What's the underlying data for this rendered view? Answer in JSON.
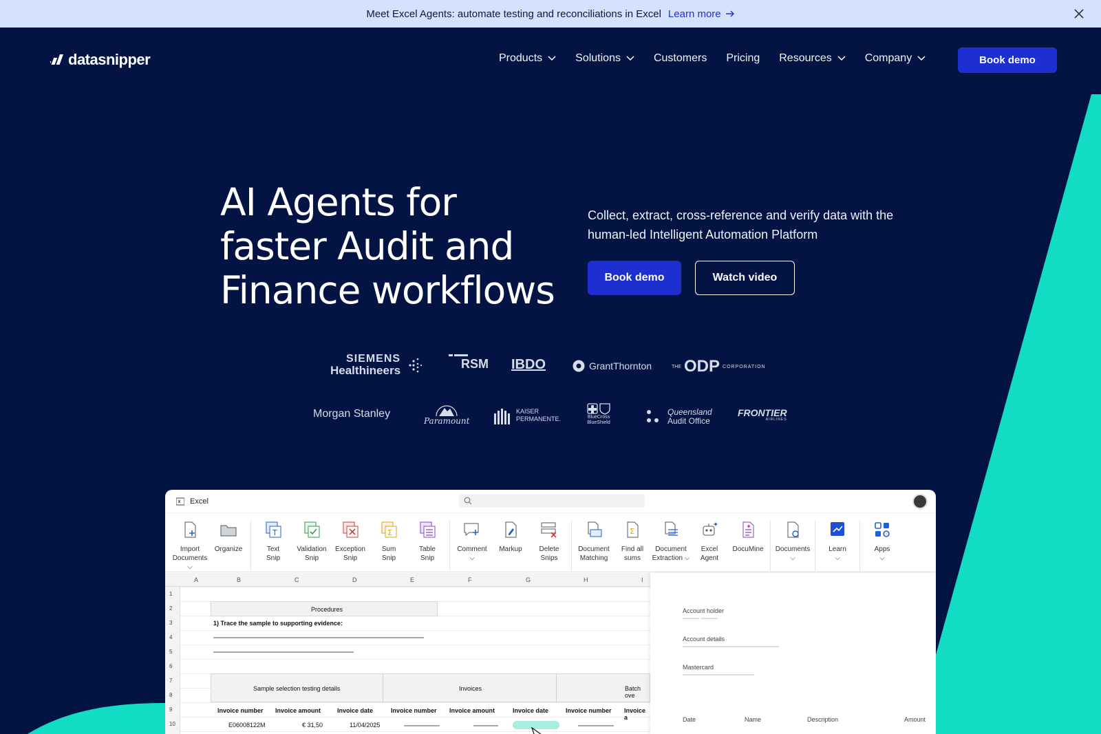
{
  "banner": {
    "text": "Meet Excel Agents: automate testing and reconciliations in Excel",
    "link": "Learn more"
  },
  "nav": {
    "logo": "datasnipper",
    "items": [
      {
        "label": "Products",
        "dropdown": true
      },
      {
        "label": "Solutions",
        "dropdown": true
      },
      {
        "label": "Customers",
        "dropdown": false
      },
      {
        "label": "Pricing",
        "dropdown": false
      },
      {
        "label": "Resources",
        "dropdown": true
      },
      {
        "label": "Company",
        "dropdown": true
      }
    ],
    "cta": "Book demo"
  },
  "hero": {
    "title_lines": [
      "AI Agents for",
      "faster Audit and",
      "Finance workflows"
    ],
    "subtitle": "Collect, extract, cross-reference and verify data with the human-led Intelligent Automation Platform",
    "primary_cta": "Book demo",
    "secondary_cta": "Watch video"
  },
  "logos": {
    "siemens_1": "SIEMENS",
    "siemens_2": "Healthineers",
    "rsm": "RSM",
    "bdo": "IBDO",
    "grant": "GrantThornton",
    "odp_the": "THE",
    "odp": "ODP",
    "odp_corp": "CORPORATION",
    "morgan": "Morgan Stanley",
    "paramount": "Paramount",
    "kaiser_1": "KAISER",
    "kaiser_2": "PERMANENTE.",
    "bcbs_1": "BlueCross",
    "bcbs_2": "BlueShield",
    "qao_1": "Queensland",
    "qao_2": "Audit Office",
    "frontier": "FRONTIER",
    "frontier_sub": "AIRLINES"
  },
  "colors": {
    "background": "#031444",
    "accent": "#1e2fd0",
    "teal": "#12dcc4",
    "banner": "#d4e2ff"
  },
  "excel": {
    "app_name": "Excel",
    "ribbon": [
      {
        "l1": "Import",
        "l2": "Documents ⌵"
      },
      {
        "l1": "Organize",
        "l2": ""
      },
      {
        "l1": "Text",
        "l2": "Snip"
      },
      {
        "l1": "Validation",
        "l2": "Snip"
      },
      {
        "l1": "Exception",
        "l2": "Snip"
      },
      {
        "l1": "Sum",
        "l2": "Snip"
      },
      {
        "l1": "Table",
        "l2": "Snip"
      },
      {
        "l1": "Comment",
        "l2": "⌵"
      },
      {
        "l1": "Markup",
        "l2": ""
      },
      {
        "l1": "Delete",
        "l2": "Snips"
      },
      {
        "l1": "Document",
        "l2": "Matching"
      },
      {
        "l1": "Find all",
        "l2": "sums"
      },
      {
        "l1": "Document",
        "l2": "Extraction ⌵"
      },
      {
        "l1": "Excel",
        "l2": "Agent"
      },
      {
        "l1": "DocuMine",
        "l2": ""
      },
      {
        "l1": "Documents",
        "l2": "⌵"
      },
      {
        "l1": "Learn",
        "l2": "⌵"
      },
      {
        "l1": "Apps",
        "l2": "⌵"
      }
    ],
    "columns": [
      "A",
      "B",
      "C",
      "D",
      "E",
      "F",
      "G",
      "H",
      "I"
    ],
    "rows": [
      "1",
      "2",
      "3",
      "4",
      "5",
      "6",
      "7",
      "8",
      "9",
      "10"
    ],
    "procedures": "Procedures",
    "step1": "1) Trace the sample to supporting evidence:",
    "group1": "Sample selection testing details",
    "group2": "Invoices",
    "group3": "Batch ove",
    "headers": [
      "Invoice number",
      "Invoice amount",
      "Invoice date",
      "Invoice number",
      "Invoice amount",
      "Invoice date",
      "Invoice number",
      "Invoice a"
    ],
    "row10": {
      "number": "E06008122M",
      "amount": "€ 31,50",
      "date": "11/04/2025"
    },
    "panel": {
      "account_holder": "Account holder",
      "account_details": "Account details",
      "mastercard": "Mastercard",
      "table_headers": [
        "Date",
        "Name",
        "Description",
        "Amount"
      ]
    }
  }
}
